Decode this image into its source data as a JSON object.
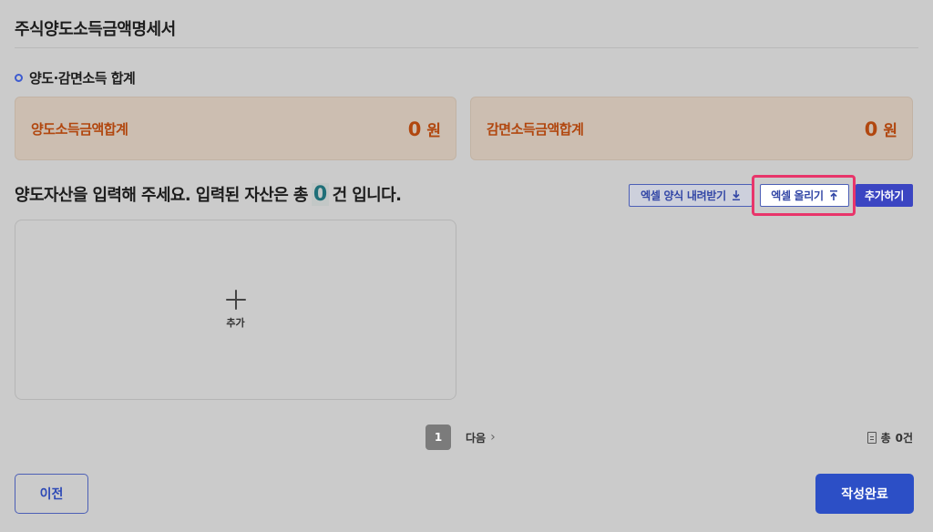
{
  "page": {
    "title": "주식양도소득금액명세서"
  },
  "summary": {
    "section_title": "양도·감면소득 합계",
    "transfer_income": {
      "label": "양도소득금액합계",
      "value": "0",
      "unit": "원"
    },
    "reduced_income": {
      "label": "감면소득금액합계",
      "value": "0",
      "unit": "원"
    }
  },
  "assets": {
    "heading_prefix": "양도자산을 입력해 주세요. 입력된 자산은 총",
    "count": "0",
    "heading_suffix": "건 입니다.",
    "download_label": "엑셀 양식 내려받기",
    "upload_label": "엑셀 올리기",
    "add_label": "추가하기",
    "add_card_label": "추가",
    "download_icon": "download-icon",
    "upload_icon": "upload-icon"
  },
  "pagination": {
    "current_page": "1",
    "next_label": "다음",
    "total_prefix": "총",
    "total_value": "0건"
  },
  "footer": {
    "prev_label": "이전",
    "complete_label": "작성완료"
  },
  "colors": {
    "accent": "#2c4fc6",
    "highlight": "#e8356a",
    "amount": "#b1470f",
    "count": "#1f6f78"
  }
}
